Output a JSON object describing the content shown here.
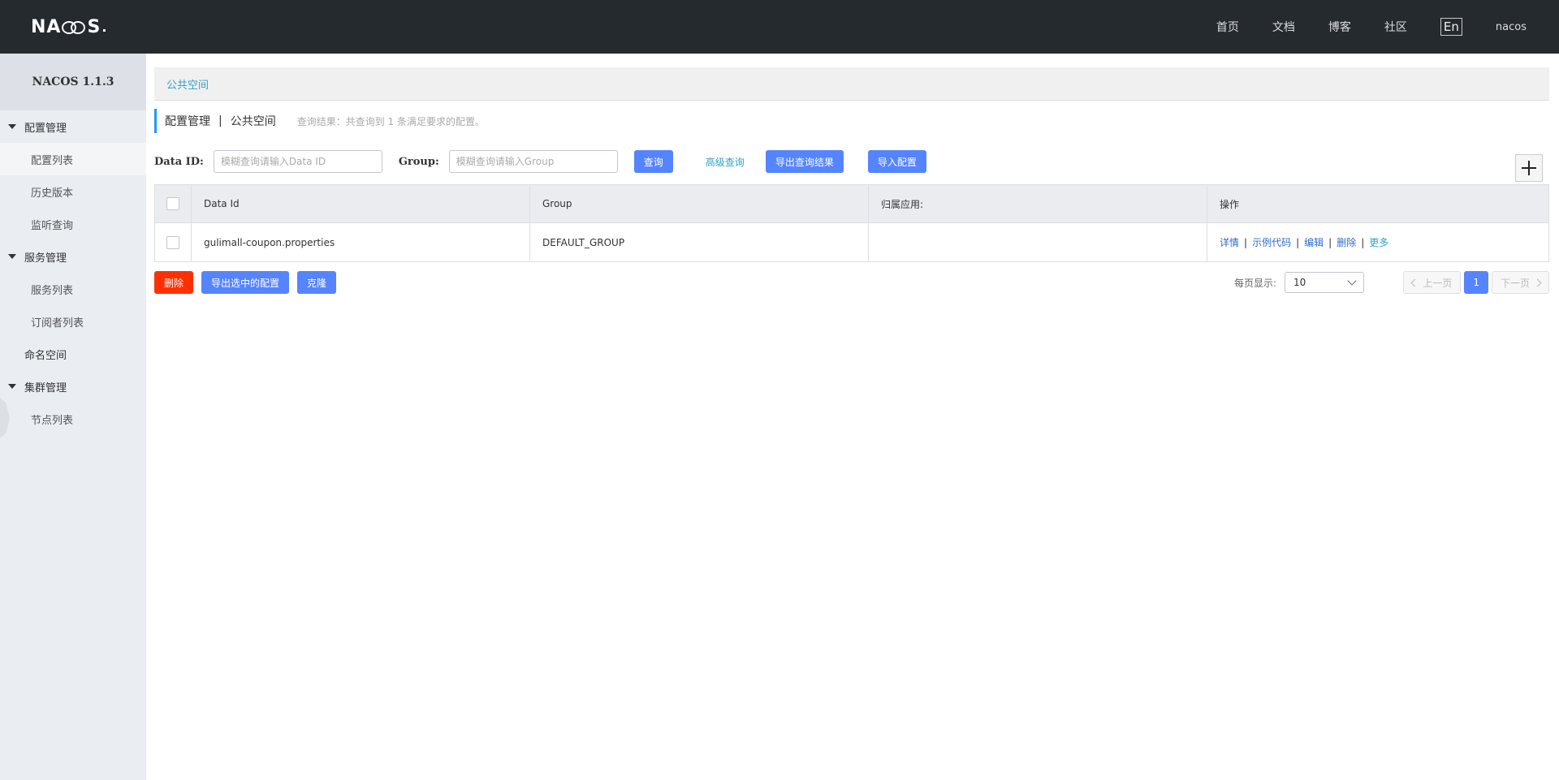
{
  "header": {
    "logo_text_left": "NA",
    "logo_text_right": "S",
    "nav": [
      "首页",
      "文档",
      "博客",
      "社区"
    ],
    "lang": "En",
    "user": "nacos"
  },
  "sidebar": {
    "brand": "NACOS 1.1.3",
    "groups": [
      {
        "label": "配置管理",
        "items": [
          "配置列表",
          "历史版本",
          "监听查询"
        ]
      },
      {
        "label": "服务管理",
        "items": [
          "服务列表",
          "订阅者列表"
        ]
      },
      {
        "label": "命名空间"
      },
      {
        "label": "集群管理",
        "items": [
          "节点列表"
        ]
      }
    ]
  },
  "breadcrumb": "公共空间",
  "title": {
    "main": "配置管理",
    "separator": "|",
    "sub": "公共空间",
    "hint": "查询结果：共查询到 1 条满足要求的配置。"
  },
  "filters": {
    "data_id_label": "Data ID:",
    "data_id_placeholder": "模糊查询请输入Data ID",
    "group_label": "Group:",
    "group_placeholder": "模糊查询请输入Group",
    "query_btn": "查询",
    "advanced_link": "高级查询",
    "export_results_btn": "导出查询结果",
    "import_btn": "导入配置"
  },
  "table": {
    "columns": [
      "Data Id",
      "Group",
      "归属应用:",
      "操作"
    ],
    "rows": [
      {
        "data_id": "gulimall-coupon.properties",
        "group": "DEFAULT_GROUP",
        "app": ""
      }
    ],
    "ops": [
      "详情",
      "示例代码",
      "编辑",
      "删除",
      "更多"
    ],
    "ops_sep": "|"
  },
  "bottom": {
    "delete_btn": "删除",
    "export_selected_btn": "导出选中的配置",
    "clone_btn": "克隆",
    "page_size_label": "每页显示:",
    "page_size_value": "10",
    "prev": "上一页",
    "current_page": "1",
    "next": "下一页"
  },
  "colors": {
    "topbar": "#252a2f",
    "primary": "#5584ff",
    "danger": "#ff3000",
    "link": "#33a1c9",
    "op_link": "#2d6ccd"
  }
}
